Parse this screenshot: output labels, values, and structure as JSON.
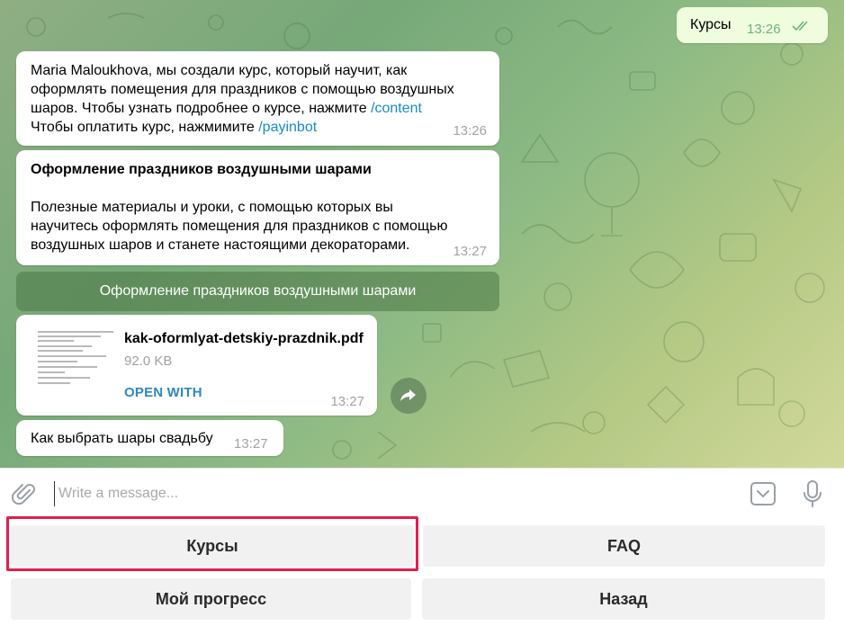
{
  "messages": {
    "outgoing_1": {
      "text": "Курсы",
      "time": "13:26"
    },
    "incoming_1": {
      "line1": "Maria Maloukhova, мы создали курс, который научит, как",
      "line2": "оформлять помещения для праздников с помощью воздушных",
      "line3_prefix": "шаров. Чтобы узнать подробнее о курсе, нажмите ",
      "line3_link": "/content",
      "line4_prefix": "Чтобы оплатить курс, нажмимите ",
      "line4_link": "/payinbot",
      "time": "13:26"
    },
    "incoming_2": {
      "heading": "Оформление праздников воздушными шарами",
      "desc_line1": "Полезные материалы и уроки, с помощью которых вы",
      "desc_line2": "научитесь оформлять помещения для праздников с помощью",
      "desc_line3": "воздушных шаров и станете настоящими декораторами.",
      "time": "13:27"
    },
    "inline_button": "Оформление праздников воздушными шарами",
    "file_message": {
      "filename": "kak-oformlyat-detskiy-prazdnik.pdf",
      "size": "92.0 KB",
      "open_label": "OPEN WITH",
      "time": "13:27"
    },
    "incoming_3": {
      "text": "Как выбрать шары свадьбу",
      "time": "13:27"
    }
  },
  "composer": {
    "placeholder": "Write a message..."
  },
  "keyboard": {
    "btn_courses": "Курсы",
    "btn_faq": "FAQ",
    "btn_progress": "Мой прогресс",
    "btn_back": "Назад"
  },
  "colors": {
    "link": "#168acd",
    "outgoing_bubble": "#effdde",
    "check_marks": "#6cb37a",
    "highlight": "#e31d4f"
  },
  "icons": [
    "double-check-icon",
    "share-icon",
    "paperclip-icon",
    "emoji-keyboard-icon",
    "microphone-icon",
    "pdf-thumbnail-icon"
  ]
}
